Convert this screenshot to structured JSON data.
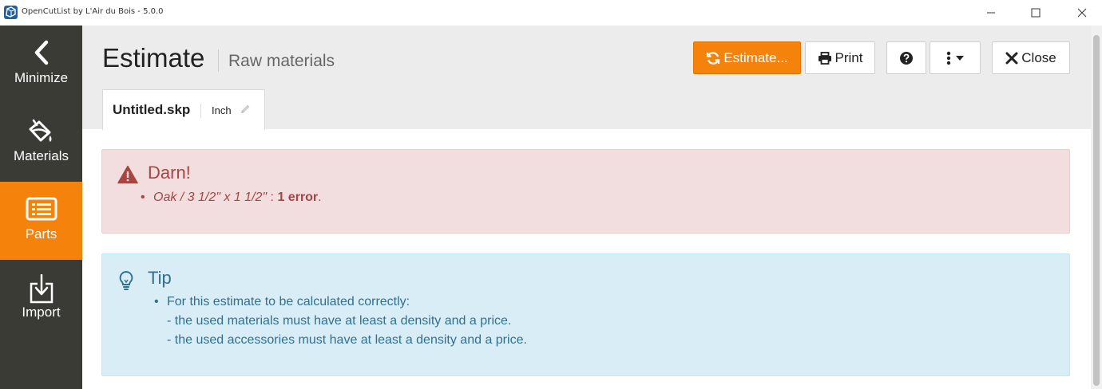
{
  "window": {
    "title": "OpenCutList by L'Air du Bois - 5.0.0",
    "controls": {
      "minimize": "─",
      "maximize": "☐",
      "close": "✕"
    }
  },
  "sidebar": {
    "items": [
      {
        "label": "Minimize",
        "icon": "chevron-left-icon",
        "active": false
      },
      {
        "label": "Materials",
        "icon": "paint-bucket-icon",
        "active": false
      },
      {
        "label": "Parts",
        "icon": "list-icon",
        "active": true
      },
      {
        "label": "Import",
        "icon": "import-icon",
        "active": false
      }
    ]
  },
  "header": {
    "title": "Estimate",
    "subtitle": "Raw materials",
    "buttons": {
      "estimate": "Estimate...",
      "print": "Print",
      "close": "Close"
    }
  },
  "tab": {
    "file_name": "Untitled.skp",
    "unit": "Inch"
  },
  "alerts": {
    "danger": {
      "title": "Darn!",
      "item_name": "Oak / 3 1/2\" x 1 1/2\"",
      "item_sep": " : ",
      "item_count": "1 error",
      "item_end": "."
    },
    "info": {
      "title": "Tip",
      "line1": "For this estimate to be calculated correctly:",
      "line2": "- the used materials must have at least a density and a price.",
      "line3": "- the used accessories must have at least a density and a price."
    }
  },
  "colors": {
    "accent": "#f5820b",
    "sidebar": "#3b3b35",
    "danger_bg": "#f2dede",
    "danger_text": "#a94442",
    "info_bg": "#d9edf7",
    "info_text": "#31708f"
  }
}
